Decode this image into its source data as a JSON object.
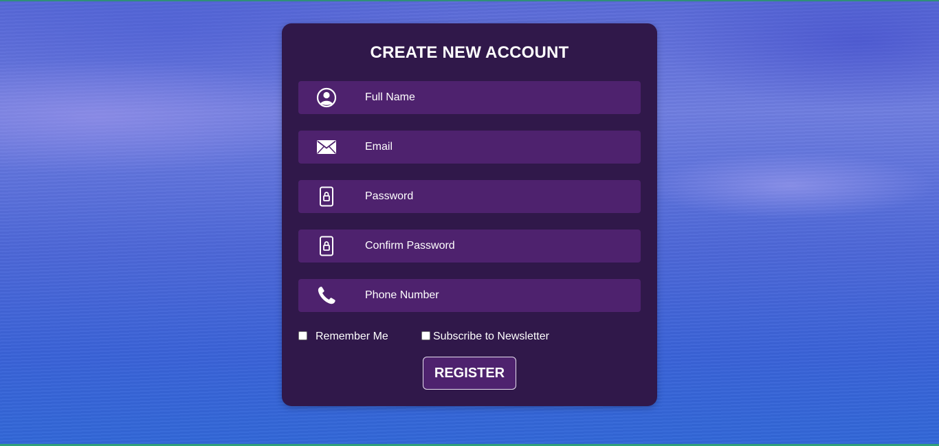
{
  "form": {
    "title": "CREATE NEW ACCOUNT",
    "fields": [
      {
        "icon": "user-circle-icon",
        "placeholder": "Full Name"
      },
      {
        "icon": "envelope-icon",
        "placeholder": "Email"
      },
      {
        "icon": "lock-icon",
        "placeholder": "Password"
      },
      {
        "icon": "lock-icon",
        "placeholder": "Confirm Password"
      },
      {
        "icon": "phone-icon",
        "placeholder": "Phone Number"
      }
    ],
    "checkboxes": [
      {
        "label": "Remember Me",
        "checked": false
      },
      {
        "label": "Subscribe to Newsletter",
        "checked": false
      }
    ],
    "submit_label": "REGISTER"
  },
  "colors": {
    "card_bg": "#30184a",
    "field_bg": "#4e226e",
    "text": "#ffffff",
    "background_blue": "#3a63d8"
  }
}
